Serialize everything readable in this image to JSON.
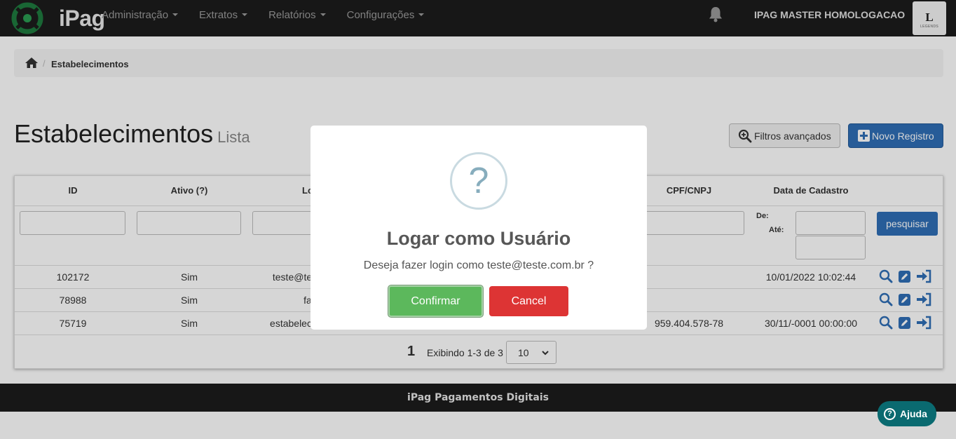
{
  "navbar": {
    "logo_text": "iPag",
    "menu": [
      {
        "label": "Administração"
      },
      {
        "label": "Extratos"
      },
      {
        "label": "Relatórios"
      },
      {
        "label": "Configurações"
      }
    ],
    "user_name": "IPAG MASTER HOMOLOGACAO",
    "avatar_letter": "L",
    "avatar_sub": "LEGENDS"
  },
  "breadcrumb": {
    "separator": "/",
    "current": "Estabelecimentos"
  },
  "page": {
    "title": "Estabelecimentos",
    "subtitle": "Lista",
    "filters_button": "Filtros avançados",
    "new_button": "Novo Registro"
  },
  "table": {
    "columns": [
      "ID",
      "Ativo (?)",
      "Lo",
      "CPF/CNPJ",
      "Data de Cadastro"
    ],
    "date_filter": {
      "from_label": "De:",
      "to_label": "Até:"
    },
    "search_button": "pesquisar",
    "rows": [
      {
        "id": "102172",
        "ativo": "Sim",
        "login": "teste@te",
        "cpf": "",
        "data": "10/01/2022 10:02:44"
      },
      {
        "id": "78988",
        "ativo": "Sim",
        "login": "fa",
        "cpf": "",
        "data": ""
      },
      {
        "id": "75719",
        "ativo": "Sim",
        "login": "estabelec",
        "cpf": "959.404.578-78",
        "data": "30/11/-0001 00:00:00"
      }
    ],
    "pagination": {
      "current_page": "1",
      "info": "Exibindo 1-3 de 3",
      "per_page": "10"
    }
  },
  "footer": {
    "text": "iPag Pagamentos Digitais"
  },
  "help": {
    "label": "Ajuda"
  },
  "modal": {
    "icon_glyph": "?",
    "title": "Logar como Usuário",
    "message": "Deseja fazer login como teste@teste.com.br ?",
    "confirm_label": "Confirmar",
    "cancel_label": "Cancel"
  },
  "colors": {
    "navbar": "#1c1c1c",
    "primary": "#2f6eb5",
    "confirm": "#5cb85c",
    "cancel": "#dd3434",
    "help": "#0a6a70"
  }
}
